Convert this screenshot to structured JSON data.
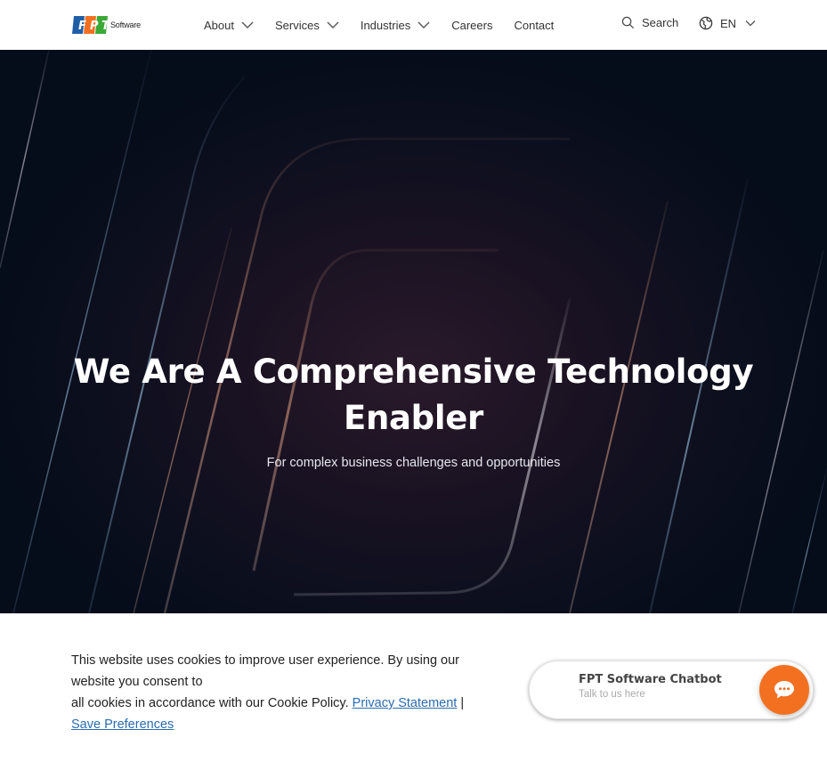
{
  "header": {
    "logo_text": "Software",
    "nav": [
      {
        "label": "About",
        "has_dropdown": true
      },
      {
        "label": "Services",
        "has_dropdown": true
      },
      {
        "label": "Industries",
        "has_dropdown": true
      },
      {
        "label": "Careers",
        "has_dropdown": false
      },
      {
        "label": "Contact",
        "has_dropdown": false
      }
    ],
    "search_label": "Search",
    "language": "EN"
  },
  "hero": {
    "title_line1": "We Are A Comprehensive Technology",
    "title_line2": "Enabler",
    "subtitle": "For complex business challenges and opportunities"
  },
  "cookie": {
    "text_line1": "This website uses cookies to improve user experience. By using our website you consent to",
    "text_line2": "all cookies in accordance with our Cookie Policy.",
    "privacy_link": "Privacy Statement",
    "separator": "|",
    "preferences_link": "Save Preferences"
  },
  "chatbot": {
    "title": "FPT Software Chatbot",
    "subtitle": "Talk to us here"
  },
  "colors": {
    "brand_blue": "#1f5fa8",
    "brand_orange": "#f37021",
    "brand_green": "#3aa935",
    "link": "#2b6cb0",
    "hero_bg": "#050c1a"
  }
}
